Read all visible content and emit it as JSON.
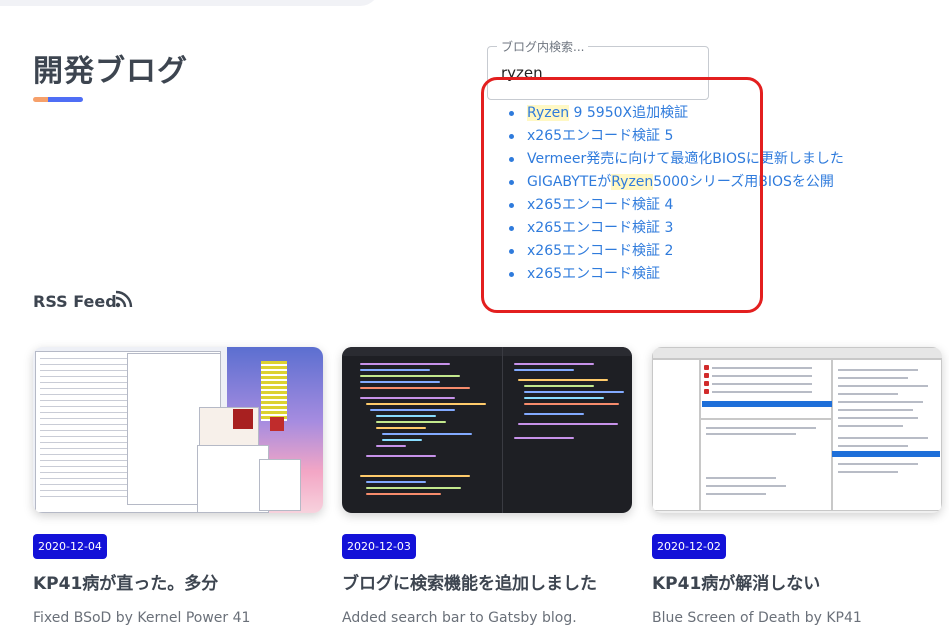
{
  "page": {
    "title": "開発ブログ",
    "colors": {
      "accent_blue": "#4f6ef5",
      "accent_orange": "#f6a06a",
      "link": "#2f7bdc",
      "date_badge": "#1311d8",
      "highlight_frame": "#e31f1f"
    }
  },
  "search": {
    "legend": "ブログ内検索...",
    "value": "ryzen",
    "results": [
      {
        "before": "",
        "match": "Ryzen",
        "after": " 9 5950X追加検証"
      },
      {
        "before": "x265エンコード検証 5",
        "match": "",
        "after": ""
      },
      {
        "before": "Vermeer発売に向けて最適化BIOSに更新しました",
        "match": "",
        "after": ""
      },
      {
        "before": "GIGABYTEが",
        "match": "Ryzen",
        "after": "5000シリーズ用BIOSを公開"
      },
      {
        "before": "x265エンコード検証 4",
        "match": "",
        "after": ""
      },
      {
        "before": "x265エンコード検証 3",
        "match": "",
        "after": ""
      },
      {
        "before": "x265エンコード検証 2",
        "match": "",
        "after": ""
      },
      {
        "before": "x265エンコード検証",
        "match": "",
        "after": ""
      }
    ]
  },
  "rss": {
    "label": "RSS Feed",
    "icon": "rss-icon"
  },
  "posts": [
    {
      "date": "2020-12-04",
      "title": "KP41病が直った。多分",
      "description": "Fixed BSoD by Kernel Power 41"
    },
    {
      "date": "2020-12-03",
      "title": "ブログに検索機能を追加しました",
      "description": "Added search bar to Gatsby blog."
    },
    {
      "date": "2020-12-02",
      "title": "KP41病が解消しない",
      "description": "Blue Screen of Death by KP41"
    }
  ]
}
